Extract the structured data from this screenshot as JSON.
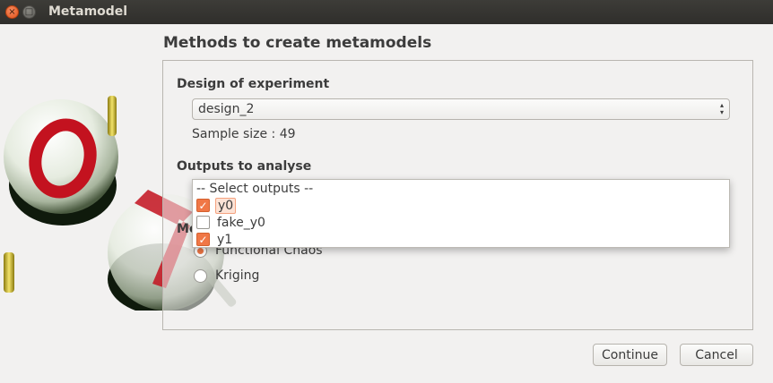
{
  "window": {
    "title": "Metamodel",
    "close_glyph": "×",
    "max_glyph": "□"
  },
  "page": {
    "heading": "Methods to create metamodels"
  },
  "design": {
    "section_label": "Design of experiment",
    "selected": "design_2",
    "arrows": "▴▾",
    "sample_size_text": "Sample size : 49"
  },
  "outputs": {
    "section_label": "Outputs to analyse",
    "placeholder": "-- Select outputs --",
    "items": [
      {
        "label": "y0",
        "checked": true,
        "highlighted": true
      },
      {
        "label": "fake_y0",
        "checked": false,
        "highlighted": false
      },
      {
        "label": "y1",
        "checked": true,
        "highlighted": false
      }
    ]
  },
  "methods": {
    "section_label_visible": "Me",
    "options": [
      {
        "label": "Functional Chaos",
        "selected": true
      },
      {
        "label": "Kriging",
        "selected": false
      }
    ]
  },
  "buttons": {
    "continue": "Continue",
    "cancel": "Cancel"
  },
  "colors": {
    "accent": "#f07746",
    "titlebar": "#3d3c38",
    "background": "#f2f1f0"
  },
  "icons": {
    "check": "✓"
  }
}
